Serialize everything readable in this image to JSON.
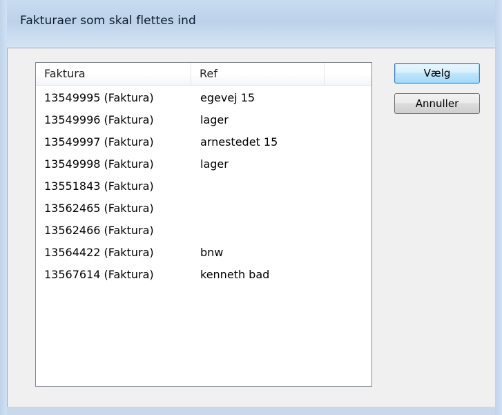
{
  "window": {
    "title": "Fakturaer som skal flettes ind"
  },
  "list": {
    "columns": [
      "Faktura",
      "Ref"
    ],
    "rows": [
      {
        "faktura": "13549995 (Faktura)",
        "ref": "egevej 15"
      },
      {
        "faktura": "13549996 (Faktura)",
        "ref": "lager"
      },
      {
        "faktura": "13549997 (Faktura)",
        "ref": "arnestedet 15"
      },
      {
        "faktura": "13549998 (Faktura)",
        "ref": "lager"
      },
      {
        "faktura": "13551843 (Faktura)",
        "ref": ""
      },
      {
        "faktura": "13562465 (Faktura)",
        "ref": ""
      },
      {
        "faktura": "13562466 (Faktura)",
        "ref": ""
      },
      {
        "faktura": "13564422 (Faktura)",
        "ref": "bnw"
      },
      {
        "faktura": "13567614 (Faktura)",
        "ref": "kenneth bad"
      }
    ]
  },
  "buttons": {
    "select_label": "Vælg",
    "cancel_label": "Annuller"
  }
}
